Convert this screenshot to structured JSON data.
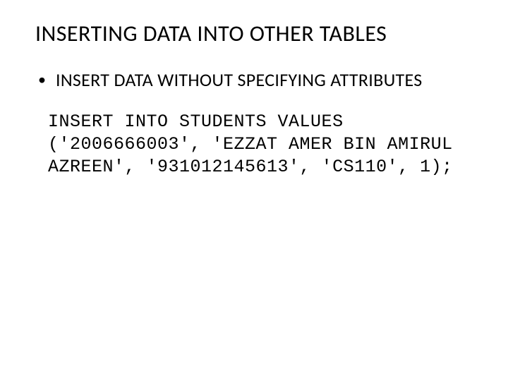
{
  "slide": {
    "title": "INSERTING DATA INTO OTHER TABLES",
    "bullet": {
      "symbol": "•",
      "text": "INSERT DATA WITHOUT SPECIFYING ATTRIBUTES"
    },
    "code": "INSERT INTO STUDENTS VALUES ('2006666003', 'EZZAT AMER BIN AMIRUL AZREEN', '931012145613', 'CS110', 1);"
  }
}
